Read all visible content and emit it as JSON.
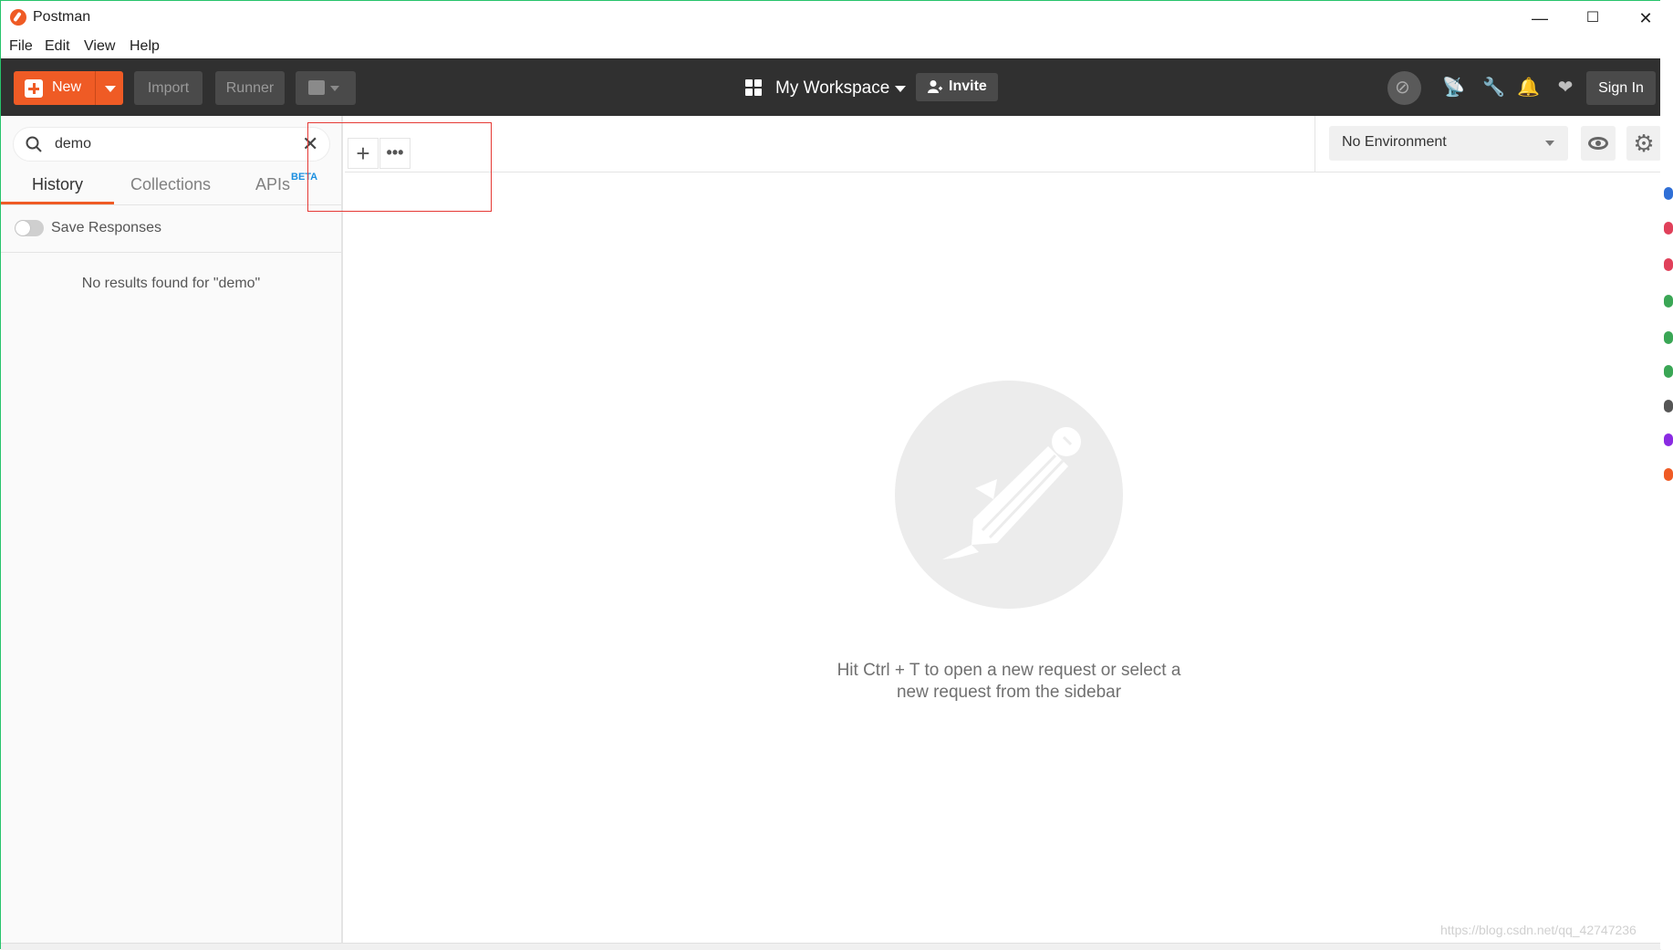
{
  "window": {
    "title": "Postman",
    "controls": {
      "minimize": "—",
      "maximize": "☐",
      "close": "✕"
    }
  },
  "menubar": [
    "File",
    "Edit",
    "View",
    "Help"
  ],
  "header": {
    "new_label": "New",
    "import_label": "Import",
    "runner_label": "Runner",
    "workspace_label": "My Workspace",
    "invite_label": "Invite",
    "signin_label": "Sign In",
    "icons": [
      "sync-off-icon",
      "satellite-icon",
      "wrench-icon",
      "bell-icon",
      "heart-icon"
    ]
  },
  "sidebar": {
    "search_value": "demo",
    "tabs": [
      {
        "label": "History",
        "active": true
      },
      {
        "label": "Collections",
        "active": false
      },
      {
        "label": "APIs",
        "badge": "BETA",
        "active": false
      }
    ],
    "save_responses_label": "Save Responses",
    "save_responses_on": false,
    "no_results": "No results found for \"demo\""
  },
  "tabbar": {
    "add_label": "+",
    "more_label": "•••",
    "environment": "No Environment"
  },
  "main": {
    "empty_text_line1": "Hit Ctrl + T to open a new request or select a",
    "empty_text_line2": "new request from the sidebar"
  },
  "colors": {
    "accent": "#ef5b25",
    "header_bg": "#303030",
    "annotation": "#e53935",
    "beta": "#1a8fe0"
  },
  "watermark": "https://blog.csdn.net/qq_42747236"
}
